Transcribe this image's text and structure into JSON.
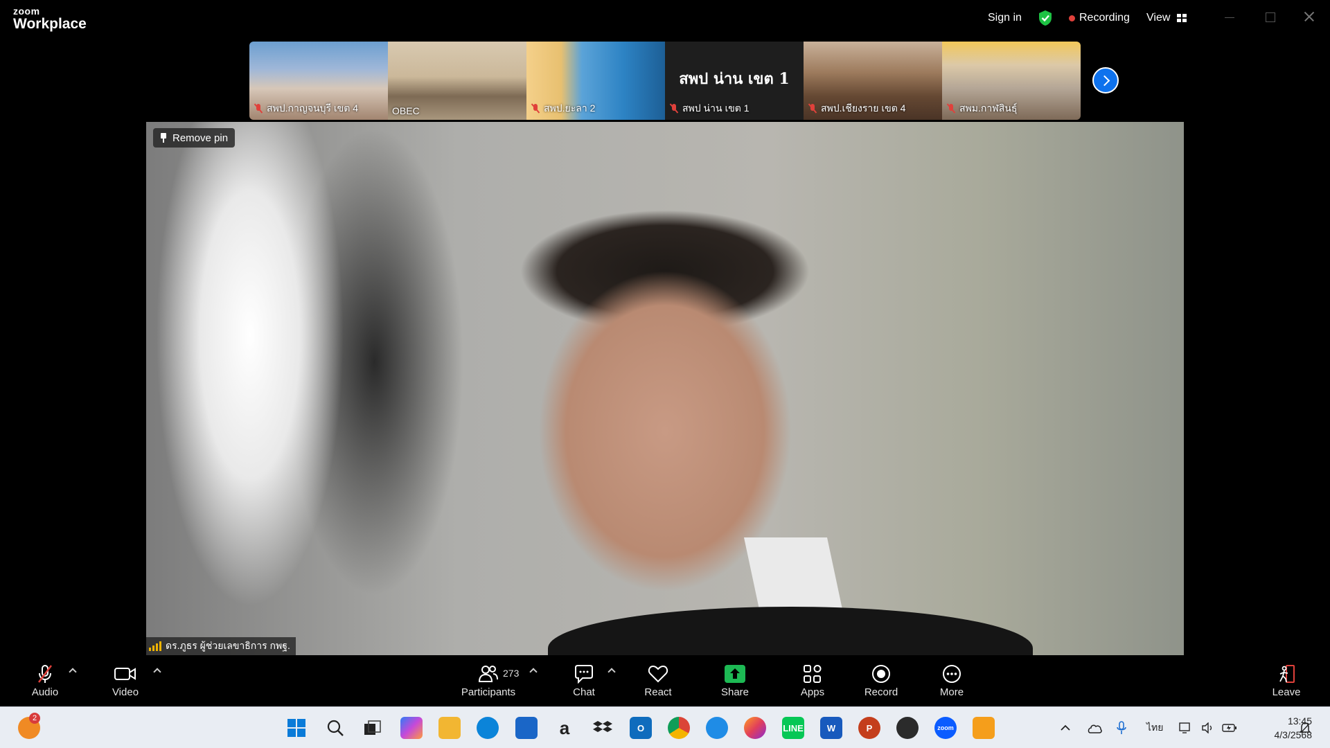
{
  "titlebar": {
    "brand_small": "zoom",
    "brand_big": "Workplace",
    "sign_in": "Sign in",
    "recording": "Recording",
    "view": "View"
  },
  "thumbnails": [
    {
      "name": "สพป.กาญจนบุรี เขต 4",
      "muted": true
    },
    {
      "name": "OBEC",
      "muted": false
    },
    {
      "name": "สพป.ยะลา 2",
      "muted": true
    },
    {
      "name": "สพป น่าน เขต 1",
      "muted": true,
      "display_text": "สพป น่าน เขต 1"
    },
    {
      "name": "สพป.เชียงราย เขต 4",
      "muted": true
    },
    {
      "name": "สพม.กาฬสินธุ์",
      "muted": true
    }
  ],
  "main": {
    "remove_pin": "Remove pin",
    "speaker_name": "ดร.ภูธร ผู้ช่วยเลขาธิการ กพฐ."
  },
  "toolbar": {
    "audio": "Audio",
    "video": "Video",
    "participants": "Participants",
    "participants_count": "273",
    "chat": "Chat",
    "react": "React",
    "share": "Share",
    "apps": "Apps",
    "record": "Record",
    "more": "More",
    "leave": "Leave"
  },
  "taskbar": {
    "notification_count": "2",
    "language": "ไทย",
    "time": "13:45",
    "date": "4/3/2568",
    "apps": [
      "start-icon",
      "search-icon",
      "task-view-icon",
      "copilot-icon",
      "file-explorer-icon",
      "edge-icon",
      "store-icon",
      "amazon-icon",
      "dropbox-icon",
      "outlook-icon",
      "chrome-icon",
      "safari-icon",
      "firefox-icon",
      "line-icon",
      "word-icon",
      "powerpoint-icon",
      "obs-icon",
      "zoom-icon",
      "app-icon"
    ]
  },
  "colors": {
    "accent_blue": "#0e72ed",
    "share_green": "#1db954",
    "recording_red": "#e0413b",
    "shield_green": "#1ec244"
  }
}
